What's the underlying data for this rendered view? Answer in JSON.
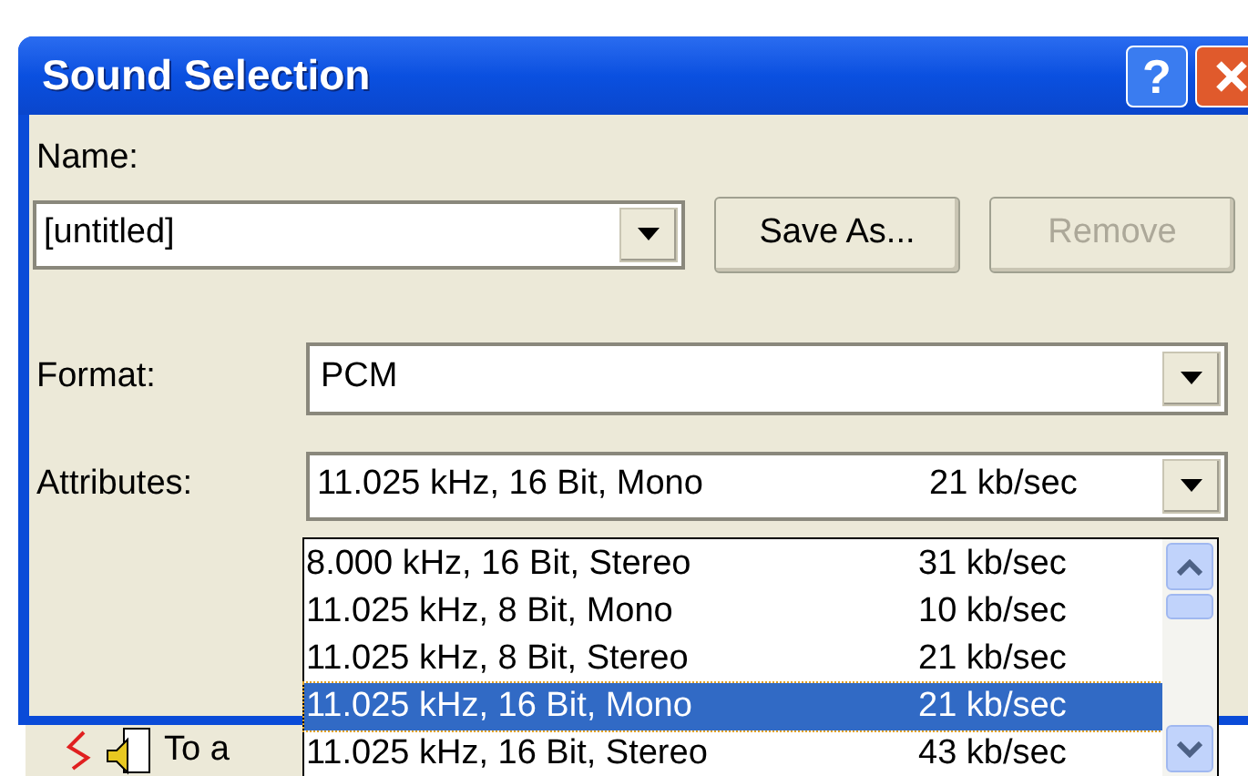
{
  "window": {
    "title": "Sound Selection",
    "help_button": "?"
  },
  "name_field": {
    "label": "Name:",
    "value": "[untitled]"
  },
  "buttons": [
    {
      "label": "Save As...",
      "disabled": false
    },
    {
      "label": "Remove",
      "disabled": true
    }
  ],
  "format_field": {
    "label": "Format:",
    "value": "PCM"
  },
  "attributes_field": {
    "label": "Attributes:",
    "value": "11.025 kHz, 16 Bit, Mono",
    "rate": "21 kb/sec"
  },
  "attributes_options": [
    {
      "label": "8.000 kHz, 16 Bit, Stereo",
      "rate": "31 kb/sec",
      "selected": false
    },
    {
      "label": "11.025 kHz, 8 Bit, Mono",
      "rate": "10 kb/sec",
      "selected": false
    },
    {
      "label": "11.025 kHz, 8 Bit, Stereo",
      "rate": "21 kb/sec",
      "selected": false
    },
    {
      "label": "11.025 kHz, 16 Bit, Mono",
      "rate": "21 kb/sec",
      "selected": true
    },
    {
      "label": "11.025 kHz, 16 Bit, Stereo",
      "rate": "43 kb/sec",
      "selected": false
    }
  ],
  "background_window": {
    "text": "To a"
  }
}
